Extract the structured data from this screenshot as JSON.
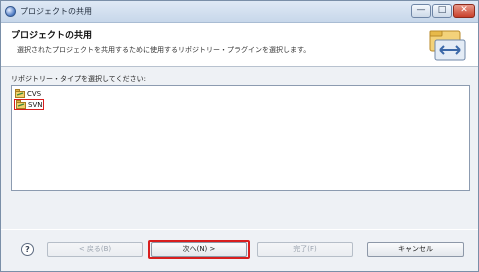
{
  "window": {
    "title": "プロジェクトの共用",
    "minimize_glyph": "—",
    "maximize_glyph": "□",
    "close_glyph": "✕"
  },
  "header": {
    "title": "プロジェクトの共用",
    "description": "選択されたプロジェクトを共用するために使用するリポジトリー・プラグインを選択します。",
    "icon": "share-project-banner-icon"
  },
  "repository_selection": {
    "label": "リポジトリー・タイプを選択してください:",
    "items": [
      {
        "label": "CVS",
        "icon": "repository-icon",
        "selected": false
      },
      {
        "label": "SVN",
        "icon": "repository-icon",
        "selected": true
      }
    ]
  },
  "footer": {
    "help_glyph": "?",
    "help_icon": "help-icon",
    "back_label": "< 戻る(B)",
    "next_label": "次へ(N) >",
    "finish_label": "完了(F)",
    "cancel_label": "キャンセル"
  },
  "colors": {
    "highlight": "#d81e1e",
    "titlebar": "#c7d7ea",
    "close_button": "#c8402b"
  }
}
